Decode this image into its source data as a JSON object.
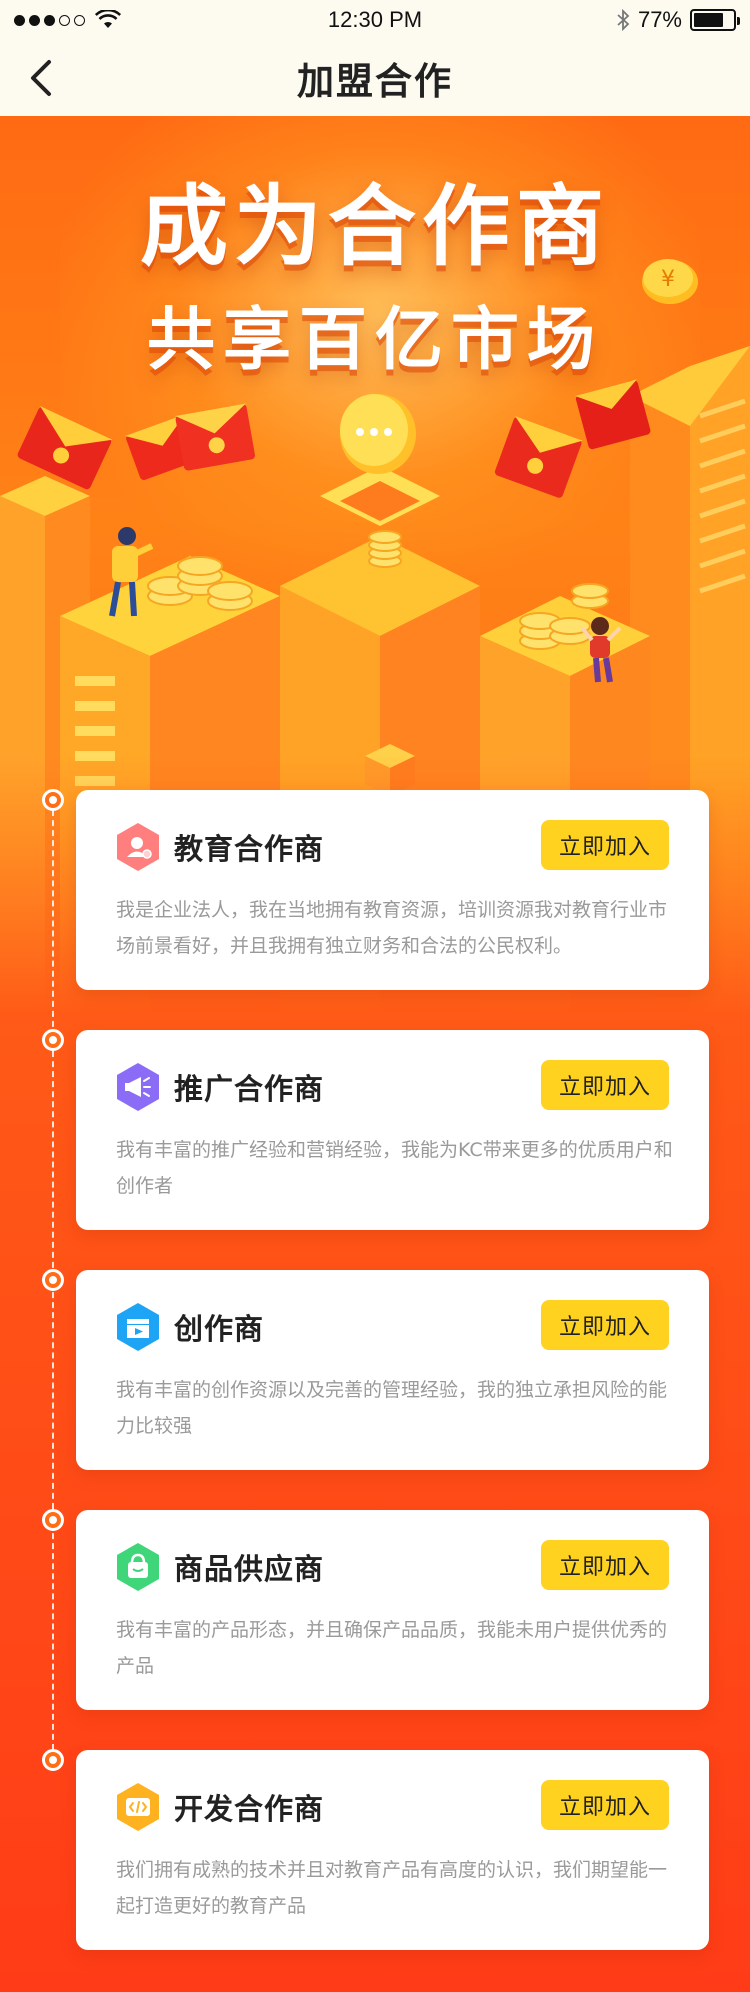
{
  "status_bar": {
    "time": "12:30 PM",
    "battery_text": "77%",
    "battery_level": 0.77,
    "signal_bars_filled": 3,
    "signal_bars_total": 5,
    "icons": [
      "signal-dots-icon",
      "wifi-icon",
      "bluetooth-icon",
      "battery-icon"
    ]
  },
  "nav": {
    "title": "加盟合作",
    "back_icon": "chevron-left-icon"
  },
  "hero": {
    "title_line1": "成为合作商",
    "title_line2": "共享百亿市场"
  },
  "cards": [
    {
      "title": "教育合作商",
      "button": "立即加入",
      "desc": "我是企业法人，我在当地拥有教育资源，培训资源我对教育行业市场前景看好，并且我拥有独立财务和合法的公民权利。",
      "icon": "user-badge-icon",
      "icon_color": "#ff7f7f"
    },
    {
      "title": "推广合作商",
      "button": "立即加入",
      "desc": "我有丰富的推广经验和营销经验，我能为KC带来更多的优质用户和创作者",
      "icon": "megaphone-icon",
      "icon_color": "#8b6cf6"
    },
    {
      "title": "创作商",
      "button": "立即加入",
      "desc": "我有丰富的创作资源以及完善的管理经验，我的独立承担风险的能力比较强",
      "icon": "video-clapper-icon",
      "icon_color": "#1ea4f4"
    },
    {
      "title": "商品供应商",
      "button": "立即加入",
      "desc": "我有丰富的产品形态，并且确保产品品质，我能未用户提供优秀的产品",
      "icon": "shopping-bag-icon",
      "icon_color": "#3fd67a"
    },
    {
      "title": "开发合作商",
      "button": "立即加入",
      "desc": "我们拥有成熟的技术并且对教育产品有高度的认识，我们期望能一起打造更好的教育产品",
      "icon": "code-icon",
      "icon_color": "#ffb21f"
    }
  ],
  "colors": {
    "accent_button": "#ffd21f",
    "hero_orange": "#ff7a17",
    "bg_bottom": "#ff3f17"
  }
}
